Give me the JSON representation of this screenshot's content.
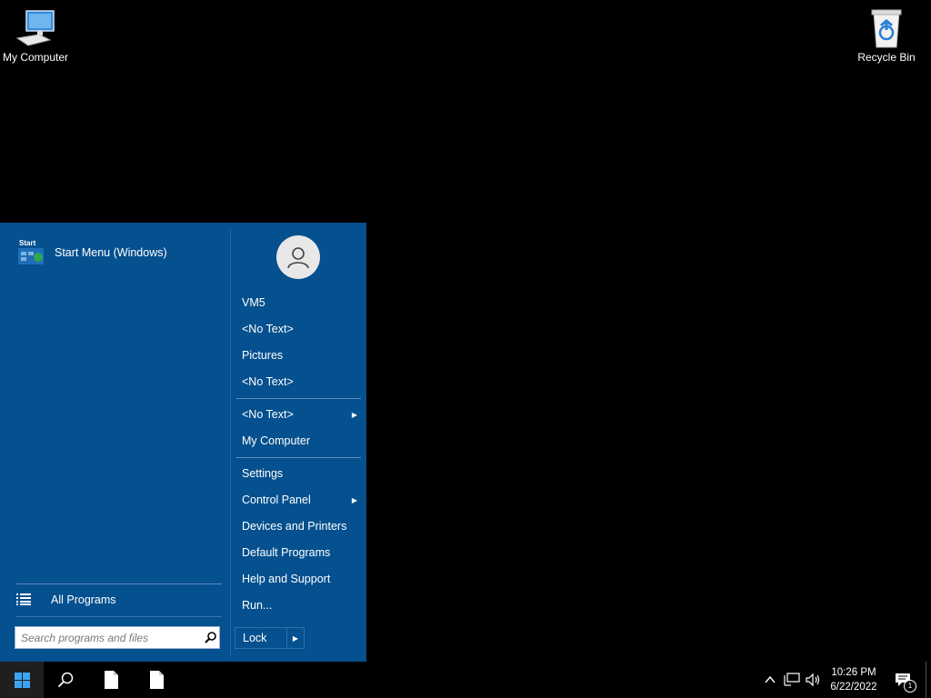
{
  "desktop": {
    "icons": [
      {
        "label": "My Computer"
      },
      {
        "label": "Recycle Bin"
      }
    ]
  },
  "start_menu": {
    "pinned": [
      {
        "label": "Start Menu (Windows)",
        "icon_text": "Start"
      }
    ],
    "all_programs_label": "All Programs",
    "search": {
      "placeholder": "Search programs and files",
      "value": ""
    },
    "right_items": [
      {
        "label": "VM5"
      },
      {
        "label": "<No Text>"
      },
      {
        "label": "Pictures"
      },
      {
        "label": "<No Text>"
      },
      {
        "label": "<No Text>",
        "submenu": true
      },
      {
        "label": "My Computer"
      },
      {
        "label": "Settings"
      },
      {
        "label": "Control Panel",
        "submenu": true
      },
      {
        "label": "Devices and Printers"
      },
      {
        "label": "Default Programs"
      },
      {
        "label": "Help and Support"
      },
      {
        "label": "Run..."
      }
    ],
    "lock_label": "Lock"
  },
  "taskbar": {
    "clock_time": "10:26 PM",
    "clock_date": "6/22/2022",
    "notification_count": "1"
  },
  "colors": {
    "menu_bg": "#05508f",
    "desktop_bg": "#000000"
  }
}
